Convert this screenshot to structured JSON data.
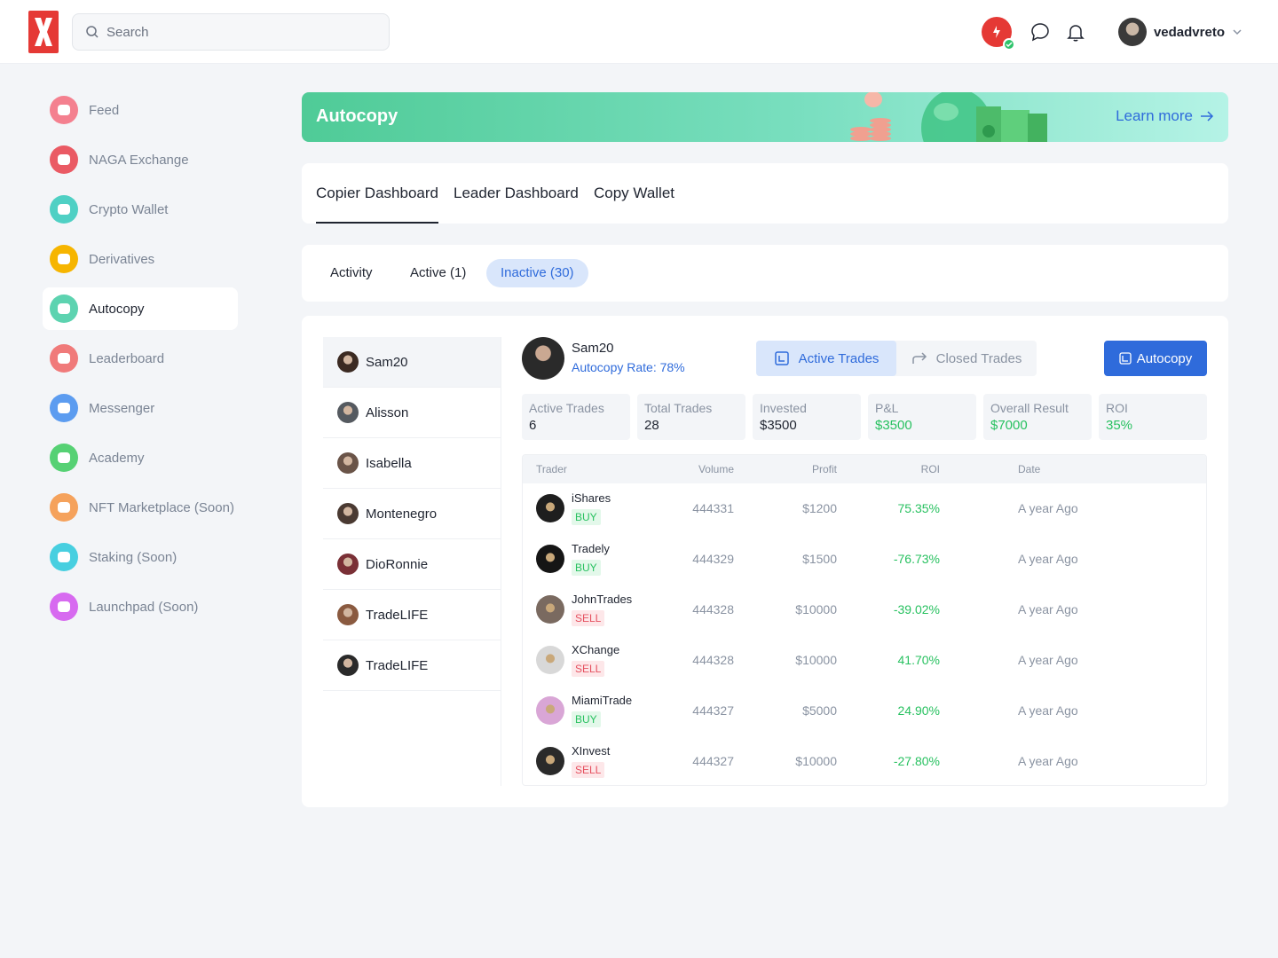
{
  "header": {
    "search_placeholder": "Search",
    "username": "vedadvreto"
  },
  "sidebar": {
    "items": [
      {
        "label": "Feed",
        "color": "#f4808f"
      },
      {
        "label": "NAGA Exchange",
        "color": "#ea5a64"
      },
      {
        "label": "Crypto Wallet",
        "color": "#4fd0c4"
      },
      {
        "label": "Derivatives",
        "color": "#f6b500"
      },
      {
        "label": "Autocopy",
        "color": "#5dd3b0"
      },
      {
        "label": "Leaderboard",
        "color": "#f07a7a"
      },
      {
        "label": "Messenger",
        "color": "#5c9cf0"
      },
      {
        "label": "Academy",
        "color": "#56d174"
      },
      {
        "label": "NFT Marketplace (Soon)",
        "color": "#f5a25c"
      },
      {
        "label": "Staking (Soon)",
        "color": "#47cfe0"
      },
      {
        "label": "Launchpad (Soon)",
        "color": "#d76af0"
      }
    ],
    "active": "Autocopy"
  },
  "banner": {
    "title": "Autocopy",
    "link": "Learn more"
  },
  "dashboard_tabs": [
    {
      "label": "Copier Dashboard",
      "active": true
    },
    {
      "label": "Leader Dashboard",
      "active": false
    },
    {
      "label": "Copy Wallet",
      "active": false
    }
  ],
  "filter_tabs": [
    {
      "label": "Activity",
      "active": false
    },
    {
      "label": "Active (1)",
      "active": false
    },
    {
      "label": "Inactive (30)",
      "active": true
    }
  ],
  "traders": [
    {
      "name": "Sam20",
      "selected": true
    },
    {
      "name": "Alisson",
      "selected": false
    },
    {
      "name": "Isabella",
      "selected": false
    },
    {
      "name": "Montenegro",
      "selected": false
    },
    {
      "name": "DioRonnie",
      "selected": false
    },
    {
      "name": "TradeLIFE",
      "selected": false
    },
    {
      "name": "TradeLIFE",
      "selected": false
    }
  ],
  "profile": {
    "name": "Sam20",
    "rate": "Autocopy Rate: 78%"
  },
  "segment": {
    "active_trades": "Active Trades",
    "closed_trades": "Closed Trades",
    "selected": "Active Trades"
  },
  "autocopy_button": "Autocopy",
  "stats": [
    {
      "label": "Active Trades",
      "value": "6",
      "positive": false
    },
    {
      "label": "Total Trades",
      "value": "28",
      "positive": false
    },
    {
      "label": "Invested",
      "value": "$3500",
      "positive": false
    },
    {
      "label": "P&L",
      "value": "$3500",
      "positive": true
    },
    {
      "label": "Overall Result",
      "value": "$7000",
      "positive": true
    },
    {
      "label": "ROI",
      "value": "35%",
      "positive": true
    }
  ],
  "table": {
    "columns": [
      "Trader",
      "Volume",
      "Profit",
      "ROI",
      "Date"
    ],
    "rows": [
      {
        "trader": "iShares",
        "side": "BUY",
        "volume": "444331",
        "profit": "$1200",
        "roi": "75.35%",
        "date": "A year Ago"
      },
      {
        "trader": "Tradely",
        "side": "BUY",
        "volume": "444329",
        "profit": "$1500",
        "roi": "-76.73%",
        "date": "A year Ago"
      },
      {
        "trader": "JohnTrades",
        "side": "SELL",
        "volume": "444328",
        "profit": "$10000",
        "roi": "-39.02%",
        "date": "A year Ago"
      },
      {
        "trader": "XChange",
        "side": "SELL",
        "volume": "444328",
        "profit": "$10000",
        "roi": "41.70%",
        "date": "A year Ago"
      },
      {
        "trader": "MiamiTrade",
        "side": "BUY",
        "volume": "444327",
        "profit": "$5000",
        "roi": "24.90%",
        "date": "A year Ago"
      },
      {
        "trader": "XInvest",
        "side": "SELL",
        "volume": "444327",
        "profit": "$10000",
        "roi": "-27.80%",
        "date": "A year Ago"
      }
    ]
  }
}
